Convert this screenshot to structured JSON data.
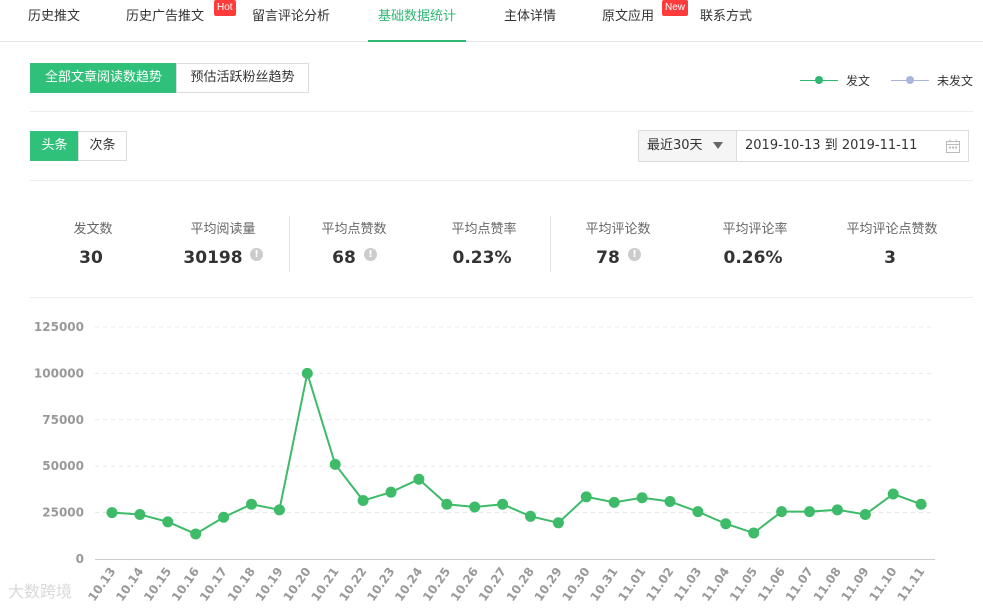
{
  "nav": {
    "tabs": [
      {
        "label": "历史推文",
        "badge": ""
      },
      {
        "label": "历史广告推文",
        "badge": "Hot"
      },
      {
        "label": "留言评论分析",
        "badge": ""
      },
      {
        "label": "基础数据统计",
        "badge": ""
      },
      {
        "label": "主体详情",
        "badge": ""
      },
      {
        "label": "原文应用",
        "badge": "New"
      },
      {
        "label": "联系方式",
        "badge": ""
      }
    ],
    "active_index": 3
  },
  "trend_tabs": {
    "all_articles": "全部文章阅读数趋势",
    "fans": "预估活跃粉丝趋势"
  },
  "legend": {
    "posted": {
      "label": "发文",
      "color": "#2fb872"
    },
    "not_posted": {
      "label": "未发文",
      "color": "#a9b6db"
    }
  },
  "position_tabs": {
    "headline": "头条",
    "secondary": "次条"
  },
  "date_filter": {
    "range_label": "最近30天",
    "value": "2019-10-13 到 2019-11-11"
  },
  "stats": [
    {
      "label": "发文数",
      "value": "30",
      "info": false
    },
    {
      "label": "平均阅读量",
      "value": "30198",
      "info": true
    },
    {
      "label": "平均点赞数",
      "value": "68",
      "info": true
    },
    {
      "label": "平均点赞率",
      "value": "0.23%",
      "info": false
    },
    {
      "label": "平均评论数",
      "value": "78",
      "info": true
    },
    {
      "label": "平均评论率",
      "value": "0.26%",
      "info": false
    },
    {
      "label": "平均评论点赞数",
      "value": "3",
      "info": false
    }
  ],
  "chart_data": {
    "type": "line",
    "categories": [
      "10.13",
      "10.14",
      "10.15",
      "10.16",
      "10.17",
      "10.18",
      "10.19",
      "10.20",
      "10.21",
      "10.22",
      "10.23",
      "10.24",
      "10.25",
      "10.26",
      "10.27",
      "10.28",
      "10.29",
      "10.30",
      "10.31",
      "11.01",
      "11.02",
      "11.03",
      "11.04",
      "11.05",
      "11.06",
      "11.07",
      "11.08",
      "11.09",
      "11.10",
      "11.11"
    ],
    "series": [
      {
        "name": "发文",
        "color": "#3dbb68",
        "values": [
          25000,
          24000,
          20000,
          13500,
          22500,
          29500,
          26500,
          100000,
          51000,
          31500,
          36000,
          43000,
          29500,
          28000,
          29500,
          23000,
          19500,
          33500,
          30500,
          33000,
          31000,
          25500,
          19000,
          14000,
          25500,
          25500,
          26500,
          24000,
          35000,
          29500
        ]
      }
    ],
    "yticks": [
      "0",
      "25000",
      "50000",
      "75000",
      "100000",
      "125000"
    ],
    "ylim": [
      0,
      125000
    ],
    "grid": true
  },
  "watermark": "大数跨境"
}
